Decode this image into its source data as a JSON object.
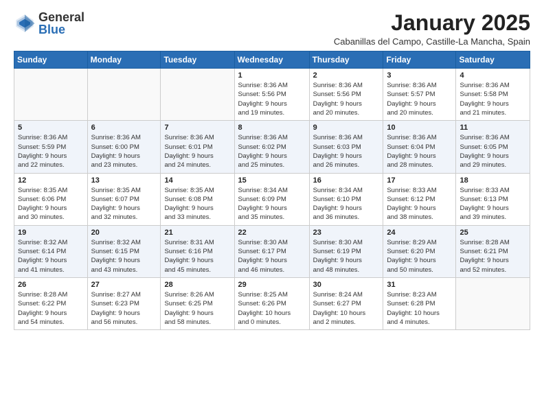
{
  "logo": {
    "general": "General",
    "blue": "Blue"
  },
  "header": {
    "title": "January 2025",
    "subtitle": "Cabanillas del Campo, Castille-La Mancha, Spain"
  },
  "weekdays": [
    "Sunday",
    "Monday",
    "Tuesday",
    "Wednesday",
    "Thursday",
    "Friday",
    "Saturday"
  ],
  "weeks": [
    [
      {
        "day": "",
        "info": ""
      },
      {
        "day": "",
        "info": ""
      },
      {
        "day": "",
        "info": ""
      },
      {
        "day": "1",
        "info": "Sunrise: 8:36 AM\nSunset: 5:56 PM\nDaylight: 9 hours\nand 19 minutes."
      },
      {
        "day": "2",
        "info": "Sunrise: 8:36 AM\nSunset: 5:56 PM\nDaylight: 9 hours\nand 20 minutes."
      },
      {
        "day": "3",
        "info": "Sunrise: 8:36 AM\nSunset: 5:57 PM\nDaylight: 9 hours\nand 20 minutes."
      },
      {
        "day": "4",
        "info": "Sunrise: 8:36 AM\nSunset: 5:58 PM\nDaylight: 9 hours\nand 21 minutes."
      }
    ],
    [
      {
        "day": "5",
        "info": "Sunrise: 8:36 AM\nSunset: 5:59 PM\nDaylight: 9 hours\nand 22 minutes."
      },
      {
        "day": "6",
        "info": "Sunrise: 8:36 AM\nSunset: 6:00 PM\nDaylight: 9 hours\nand 23 minutes."
      },
      {
        "day": "7",
        "info": "Sunrise: 8:36 AM\nSunset: 6:01 PM\nDaylight: 9 hours\nand 24 minutes."
      },
      {
        "day": "8",
        "info": "Sunrise: 8:36 AM\nSunset: 6:02 PM\nDaylight: 9 hours\nand 25 minutes."
      },
      {
        "day": "9",
        "info": "Sunrise: 8:36 AM\nSunset: 6:03 PM\nDaylight: 9 hours\nand 26 minutes."
      },
      {
        "day": "10",
        "info": "Sunrise: 8:36 AM\nSunset: 6:04 PM\nDaylight: 9 hours\nand 28 minutes."
      },
      {
        "day": "11",
        "info": "Sunrise: 8:36 AM\nSunset: 6:05 PM\nDaylight: 9 hours\nand 29 minutes."
      }
    ],
    [
      {
        "day": "12",
        "info": "Sunrise: 8:35 AM\nSunset: 6:06 PM\nDaylight: 9 hours\nand 30 minutes."
      },
      {
        "day": "13",
        "info": "Sunrise: 8:35 AM\nSunset: 6:07 PM\nDaylight: 9 hours\nand 32 minutes."
      },
      {
        "day": "14",
        "info": "Sunrise: 8:35 AM\nSunset: 6:08 PM\nDaylight: 9 hours\nand 33 minutes."
      },
      {
        "day": "15",
        "info": "Sunrise: 8:34 AM\nSunset: 6:09 PM\nDaylight: 9 hours\nand 35 minutes."
      },
      {
        "day": "16",
        "info": "Sunrise: 8:34 AM\nSunset: 6:10 PM\nDaylight: 9 hours\nand 36 minutes."
      },
      {
        "day": "17",
        "info": "Sunrise: 8:33 AM\nSunset: 6:12 PM\nDaylight: 9 hours\nand 38 minutes."
      },
      {
        "day": "18",
        "info": "Sunrise: 8:33 AM\nSunset: 6:13 PM\nDaylight: 9 hours\nand 39 minutes."
      }
    ],
    [
      {
        "day": "19",
        "info": "Sunrise: 8:32 AM\nSunset: 6:14 PM\nDaylight: 9 hours\nand 41 minutes."
      },
      {
        "day": "20",
        "info": "Sunrise: 8:32 AM\nSunset: 6:15 PM\nDaylight: 9 hours\nand 43 minutes."
      },
      {
        "day": "21",
        "info": "Sunrise: 8:31 AM\nSunset: 6:16 PM\nDaylight: 9 hours\nand 45 minutes."
      },
      {
        "day": "22",
        "info": "Sunrise: 8:30 AM\nSunset: 6:17 PM\nDaylight: 9 hours\nand 46 minutes."
      },
      {
        "day": "23",
        "info": "Sunrise: 8:30 AM\nSunset: 6:19 PM\nDaylight: 9 hours\nand 48 minutes."
      },
      {
        "day": "24",
        "info": "Sunrise: 8:29 AM\nSunset: 6:20 PM\nDaylight: 9 hours\nand 50 minutes."
      },
      {
        "day": "25",
        "info": "Sunrise: 8:28 AM\nSunset: 6:21 PM\nDaylight: 9 hours\nand 52 minutes."
      }
    ],
    [
      {
        "day": "26",
        "info": "Sunrise: 8:28 AM\nSunset: 6:22 PM\nDaylight: 9 hours\nand 54 minutes."
      },
      {
        "day": "27",
        "info": "Sunrise: 8:27 AM\nSunset: 6:23 PM\nDaylight: 9 hours\nand 56 minutes."
      },
      {
        "day": "28",
        "info": "Sunrise: 8:26 AM\nSunset: 6:25 PM\nDaylight: 9 hours\nand 58 minutes."
      },
      {
        "day": "29",
        "info": "Sunrise: 8:25 AM\nSunset: 6:26 PM\nDaylight: 10 hours\nand 0 minutes."
      },
      {
        "day": "30",
        "info": "Sunrise: 8:24 AM\nSunset: 6:27 PM\nDaylight: 10 hours\nand 2 minutes."
      },
      {
        "day": "31",
        "info": "Sunrise: 8:23 AM\nSunset: 6:28 PM\nDaylight: 10 hours\nand 4 minutes."
      },
      {
        "day": "",
        "info": ""
      }
    ]
  ]
}
